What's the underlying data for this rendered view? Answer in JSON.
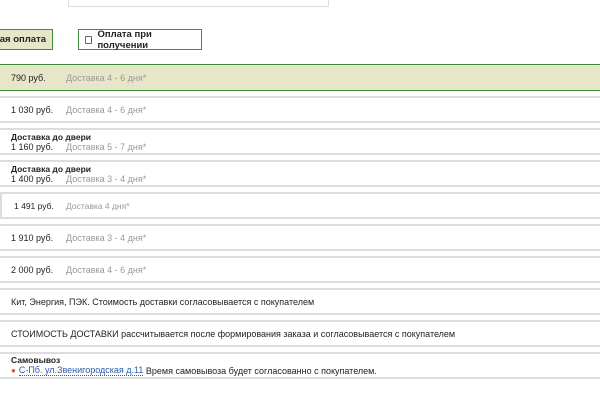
{
  "payment": {
    "selected": "ная оплата",
    "option": "Оплата при получении"
  },
  "rows": [
    {
      "price": "790 руб.",
      "term": "Доставка 4 - 6 дня*"
    },
    {
      "price": "1 030 руб.",
      "term": "Доставка 4 - 6 дня*"
    },
    {
      "title": "Доставка до двери",
      "price": "1 160 руб.",
      "term": "Доставка 5 - 7 дня*"
    },
    {
      "title": "Доставка до двери",
      "price": "1 400 руб.",
      "term": "Доставка 3 - 4 дня*"
    },
    {
      "price": "1 491 руб.",
      "term": "Доставка 4 дня*"
    },
    {
      "price": "1 910 руб.",
      "term": "Доставка 3 - 4 дня*"
    },
    {
      "price": "2 000 руб.",
      "term": "Доставка 4 - 6 дня*"
    }
  ],
  "notes": [
    "Кит, Энергия, ПЭК. Стоимость доставки согласовывается с покупателем",
    "СТОИМОСТЬ ДОСТАВКИ рассчитывается после формирования заказа и согласовывается с покупателем"
  ],
  "pickup": {
    "title": "Самовывоз",
    "address": "С-Пб. ул.Звенигородская д.11",
    "text": "Время самовывоза будет согласованно с покупателем.",
    "icon": "map-pin-icon"
  },
  "colors": {
    "accent": "#3a8a3a",
    "selected_bg": "#e7e6c9"
  }
}
